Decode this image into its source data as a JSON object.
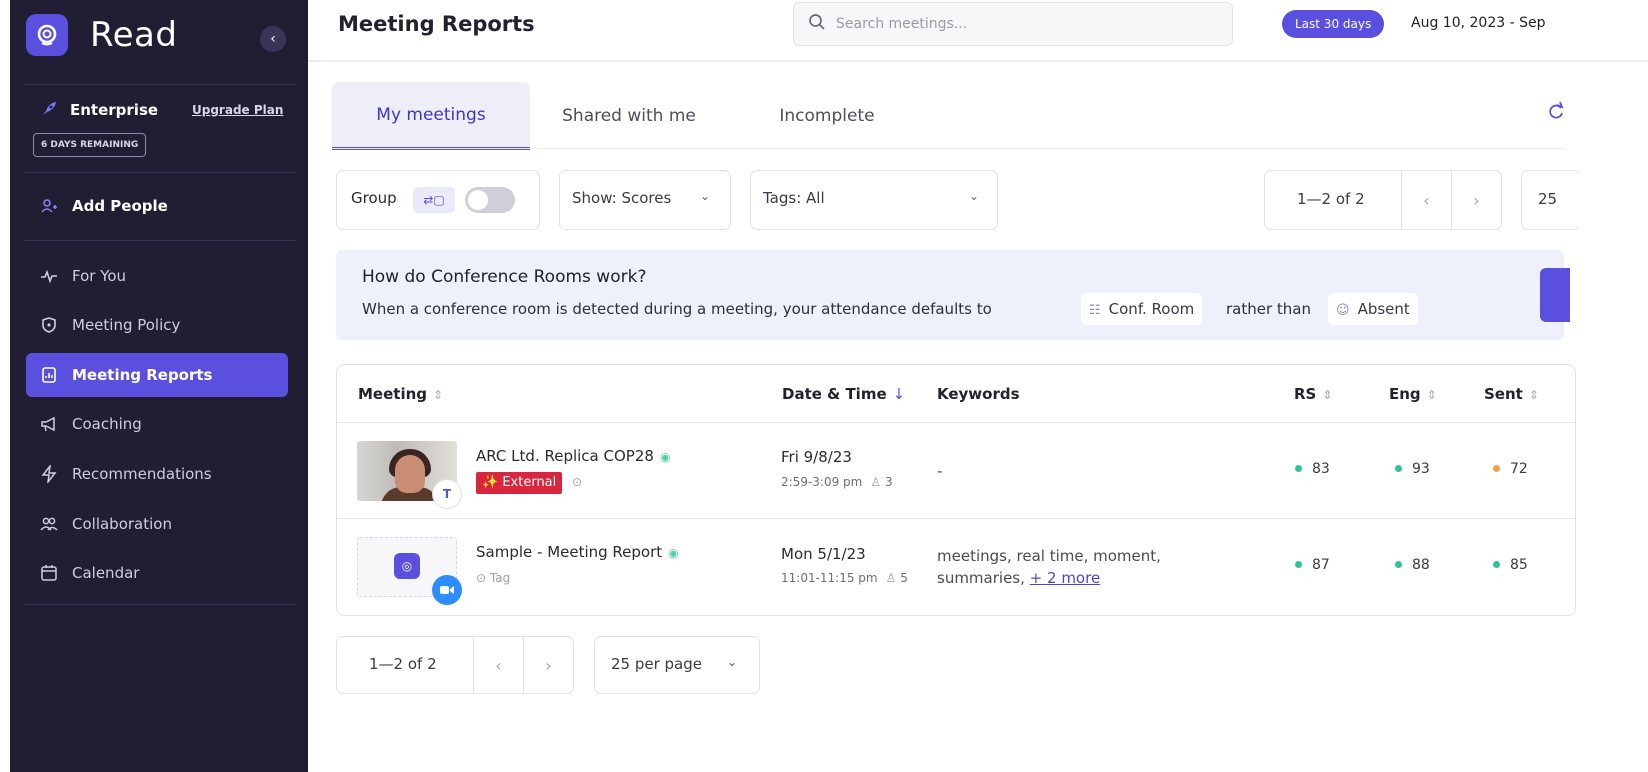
{
  "app": {
    "name": "Read"
  },
  "sidebar": {
    "plan": {
      "name": "Enterprise",
      "upgrade_label": "Upgrade Plan",
      "days_remaining": "6 DAYS REMAINING"
    },
    "add_people": "Add People",
    "items": [
      {
        "label": "For You",
        "icon": "pulse-icon"
      },
      {
        "label": "Meeting Policy",
        "icon": "shield-icon"
      },
      {
        "label": "Meeting Reports",
        "icon": "report-icon",
        "active": true
      },
      {
        "label": "Coaching",
        "icon": "megaphone-icon"
      },
      {
        "label": "Recommendations",
        "icon": "bolt-icon"
      },
      {
        "label": "Collaboration",
        "icon": "people-icon"
      },
      {
        "label": "Calendar",
        "icon": "calendar-icon"
      }
    ]
  },
  "header": {
    "title": "Meeting Reports",
    "search_placeholder": "Search meetings...",
    "date_preset": "Last 30 days",
    "date_range": "Aug 10, 2023 - Sep"
  },
  "tabs": [
    {
      "label": "My meetings",
      "active": true
    },
    {
      "label": "Shared with me"
    },
    {
      "label": "Incomplete"
    }
  ],
  "filters": {
    "group_label": "Group",
    "show_label": "Show: Scores",
    "tags_label": "Tags: All",
    "pagination": "1—2 of 2",
    "per_page_partial": "25"
  },
  "banner": {
    "title": "How do Conference Rooms work?",
    "text_before": "When a conference room is detected during a meeting, your attendance defaults to",
    "chip_conf": "Conf. Room",
    "text_middle": "rather than",
    "chip_absent": "Absent"
  },
  "table": {
    "columns": {
      "meeting": "Meeting",
      "date_time": "Date & Time",
      "keywords": "Keywords",
      "rs": "RS",
      "eng": "Eng",
      "sent": "Sent"
    },
    "rows": [
      {
        "title": "ARC Ltd. Replica COP28",
        "badge": "✨ External",
        "date": "Fri 9/8/23",
        "time": "2:59-3:09 pm",
        "attendees": "3",
        "keywords_line1": "-",
        "keywords_line2": "",
        "more": "",
        "rs": "83",
        "eng": "93",
        "sent": "72",
        "rs_color": "#2fc39a",
        "eng_color": "#2fc39a",
        "sent_color": "#f0a24a",
        "app": "teams"
      },
      {
        "title": "Sample - Meeting Report",
        "tag_label": "Tag",
        "date": "Mon 5/1/23",
        "time": "11:01-11:15 pm",
        "attendees": "5",
        "keywords_line1": "meetings, real time, moment,",
        "keywords_line2": "summaries,",
        "more": "+ 2 more",
        "rs": "87",
        "eng": "88",
        "sent": "85",
        "rs_color": "#2fc39a",
        "eng_color": "#2fc39a",
        "sent_color": "#2fc39a",
        "app": "zoom"
      }
    ]
  },
  "footer": {
    "pagination": "1—2 of 2",
    "per_page": "25 per page"
  },
  "colors": {
    "accent": "#5b4fe0",
    "sidebar_bg": "#211d33",
    "external_badge": "#d7263d",
    "score_good": "#2fc39a",
    "score_warn": "#f0a24a"
  }
}
